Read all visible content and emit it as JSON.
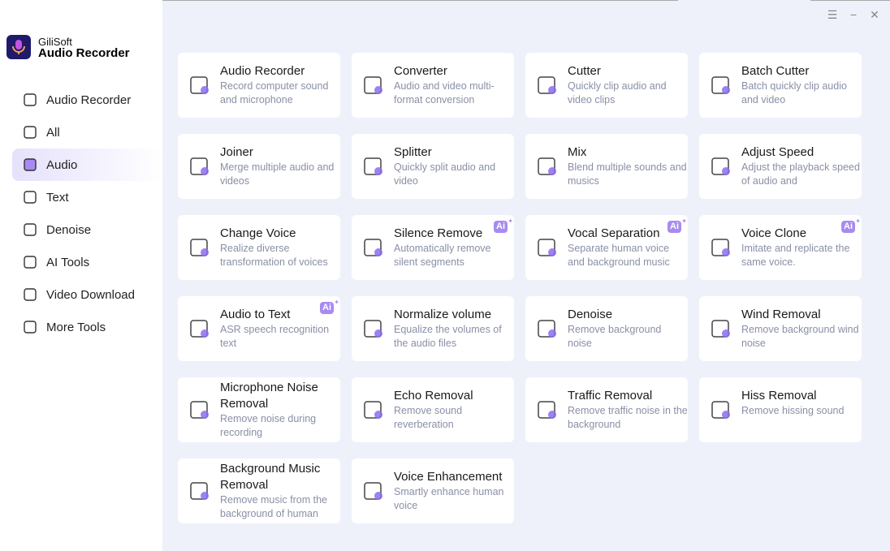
{
  "app": {
    "brand_line1": "GiliSoft",
    "brand_line2": "Audio Recorder"
  },
  "window": {
    "menu_icon": "hamburger-icon",
    "minimize_icon": "minimize-icon",
    "close_icon": "close-icon"
  },
  "sidebar": {
    "items": [
      {
        "label": "Audio Recorder",
        "icon": "microphone"
      },
      {
        "label": "All",
        "icon": "grid"
      },
      {
        "label": "Audio",
        "icon": "speaker",
        "active": true
      },
      {
        "label": "Text",
        "icon": "text"
      },
      {
        "label": "Denoise",
        "icon": "denoise"
      },
      {
        "label": "AI Tools",
        "icon": "ai"
      },
      {
        "label": "Video Download",
        "icon": "download"
      },
      {
        "label": "More Tools",
        "icon": "toolbox"
      }
    ]
  },
  "tools": [
    {
      "title": "Audio Recorder",
      "desc": "Record computer sound and microphone",
      "icon": "microphone",
      "ai": false
    },
    {
      "title": "Converter",
      "desc": "Audio and video multi-format conversion",
      "icon": "converter",
      "ai": false
    },
    {
      "title": "Cutter",
      "desc": "Quickly clip audio and video clips",
      "icon": "film-cut",
      "ai": false
    },
    {
      "title": "Batch Cutter",
      "desc": "Batch quickly clip audio and video",
      "icon": "film-batch",
      "ai": false
    },
    {
      "title": "Joiner",
      "desc": "Merge multiple audio and videos",
      "icon": "join",
      "ai": false
    },
    {
      "title": "Splitter",
      "desc": "Quickly split audio and video",
      "icon": "split",
      "ai": false
    },
    {
      "title": "Mix",
      "desc": "Blend multiple sounds and musics",
      "icon": "waveform-music",
      "ai": false
    },
    {
      "title": "Adjust Speed",
      "desc": "Adjust the playback speed of audio and",
      "icon": "speedometer",
      "ai": false
    },
    {
      "title": "Change Voice",
      "desc": "Realize diverse transformation of voices",
      "icon": "change-voice",
      "ai": false
    },
    {
      "title": "Silence Remove",
      "desc": "Automatically remove silent segments",
      "icon": "silence",
      "ai": true
    },
    {
      "title": "Vocal Separation",
      "desc": "Separate human voice and background music",
      "icon": "vocal-separation",
      "ai": true
    },
    {
      "title": "Voice Clone",
      "desc": "Imitate and replicate the same voice.",
      "icon": "voice-clone",
      "ai": true
    },
    {
      "title": "Audio to Text",
      "desc": "ASR speech recognition text",
      "icon": "speech-text",
      "ai": true
    },
    {
      "title": "Normalize volume",
      "desc": "Equalize the volumes of the audio files",
      "icon": "equalizer",
      "ai": false
    },
    {
      "title": "Denoise",
      "desc": "Remove background noise",
      "icon": "headphones",
      "ai": false
    },
    {
      "title": "Wind Removal",
      "desc": "Remove background wind noise",
      "icon": "wind",
      "ai": false
    },
    {
      "title": "Microphone Noise Removal",
      "desc": "Remove noise during recording",
      "icon": "mic-noise",
      "ai": false
    },
    {
      "title": "Echo Removal",
      "desc": "Remove sound reverberation",
      "icon": "echo",
      "ai": false
    },
    {
      "title": "Traffic Removal",
      "desc": "Remove traffic noise in the background",
      "icon": "car",
      "ai": false
    },
    {
      "title": "Hiss Removal",
      "desc": "Remove hissing sound",
      "icon": "hiss",
      "ai": false
    },
    {
      "title": "Background Music Removal",
      "desc": "Remove music from the background of human",
      "icon": "music-removal",
      "ai": false
    },
    {
      "title": "Voice Enhancement",
      "desc": "Smartly enhance human voice",
      "icon": "voice-enhance",
      "ai": false
    }
  ],
  "ai_badge": "Ai",
  "colors": {
    "accent": "#8b6cf0",
    "bg": "#eff1fa"
  }
}
